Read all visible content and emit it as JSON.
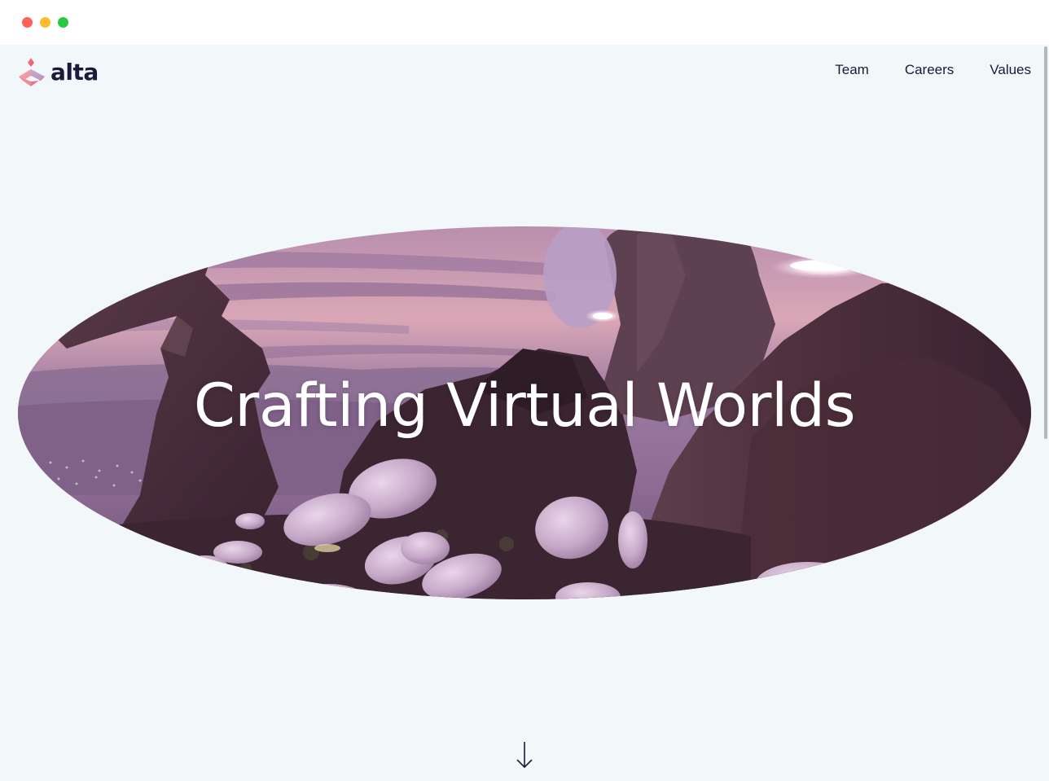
{
  "browser": {
    "controls": [
      "close",
      "minimize",
      "maximize"
    ]
  },
  "brand": {
    "name": "alta",
    "logo_icon": "alta-logo-icon",
    "text_color": "#1c1a3a"
  },
  "nav": {
    "items": [
      {
        "label": "Team"
      },
      {
        "label": "Careers"
      },
      {
        "label": "Values"
      }
    ]
  },
  "hero": {
    "title": "Crafting Virtual Worlds"
  },
  "scroll_indicator": {
    "icon": "arrow-down-icon"
  },
  "colors": {
    "page_background": "#f2f7fa",
    "text": "#1c1a3a"
  }
}
